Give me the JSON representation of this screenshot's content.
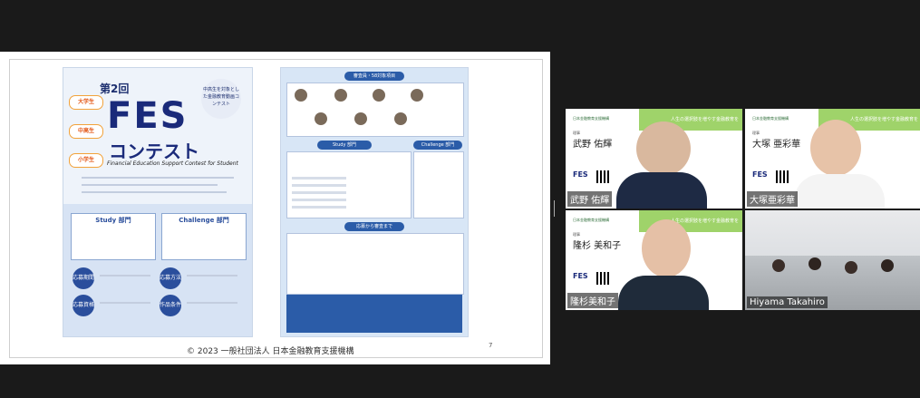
{
  "shared_screen": {
    "footer": "© 2023 一般社団法人 日本金融教育支援機構",
    "page_number": "7",
    "poster_left": {
      "title_round": "第2回",
      "fes": "FES",
      "contest": "コンテスト",
      "subtitle": "Financial Education Support Contest for Student",
      "tag": "中高生を対象とした金融教育動画コンテスト",
      "bubbles": [
        "大学生",
        "中高生",
        "小学生"
      ],
      "sections": [
        "Study 部門",
        "Challenge 部門"
      ],
      "circles": [
        "応募期間",
        "応募資格",
        "応募方法",
        "作品条件"
      ]
    },
    "poster_right": {
      "heads": [
        "審査員・58対象項目",
        "Study 部門",
        "Challenge 部門",
        "応募から審査まで"
      ]
    }
  },
  "participants": [
    {
      "org": "日本金融教育支援機構",
      "name_small": "理事",
      "name": "武野 佑輝",
      "label": "武野 佑輝"
    },
    {
      "org": "日本金融教育支援機構",
      "name_small": "理事",
      "name": "大塚 亜彩華",
      "label": "大塚亜彩華"
    },
    {
      "org": "日本金融教育支援機構",
      "name_small": "理事",
      "name": "隆杉 美和子",
      "label": "隆杉美和子"
    },
    {
      "label": "Hiyama Takahiro"
    }
  ],
  "banner_text": "人生の選択肢を増やす金融教育を",
  "colors": {
    "active_speaker": "#f5d000",
    "banner_green": "#9fd36a"
  }
}
